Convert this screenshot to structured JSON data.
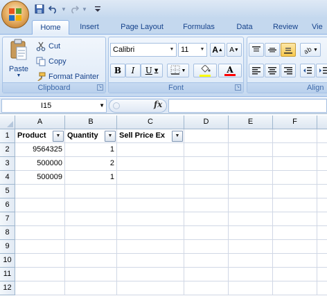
{
  "quick_access": {
    "save_icon": "save-icon",
    "undo_icon": "undo-icon",
    "redo_icon": "redo-icon",
    "customize_icon": "customize-qat-icon"
  },
  "tabs": [
    {
      "label": "Home"
    },
    {
      "label": "Insert"
    },
    {
      "label": "Page Layout"
    },
    {
      "label": "Formulas"
    },
    {
      "label": "Data"
    },
    {
      "label": "Review"
    },
    {
      "label": "Vie"
    }
  ],
  "ribbon": {
    "clipboard": {
      "label": "Clipboard",
      "paste": "Paste",
      "cut": "Cut",
      "copy": "Copy",
      "format_painter": "Format Painter"
    },
    "font": {
      "label": "Font",
      "font_name": "Calibri",
      "font_size": "11",
      "bold": "B",
      "italic": "I",
      "underline": "U",
      "grow": "A",
      "shrink": "A",
      "font_color": "A",
      "fill_color_accent": "#ffff00",
      "font_color_accent": "#ff0000"
    },
    "alignment": {
      "label": "Align"
    }
  },
  "formula_bar": {
    "name_box": "I15",
    "fx": "fx",
    "formula": ""
  },
  "sheet": {
    "columns": [
      "A",
      "B",
      "C",
      "D",
      "E",
      "F"
    ],
    "rows": [
      "1",
      "2",
      "3",
      "4",
      "5",
      "6",
      "7",
      "8",
      "9",
      "10",
      "11",
      "12"
    ],
    "headers": {
      "A": "Product",
      "B": "Quantity",
      "C": "Sell Price Ex"
    },
    "data": [
      {
        "A": "9564325",
        "B": "1"
      },
      {
        "A": "500000",
        "B": "2"
      },
      {
        "A": "500009",
        "B": "1"
      }
    ]
  }
}
